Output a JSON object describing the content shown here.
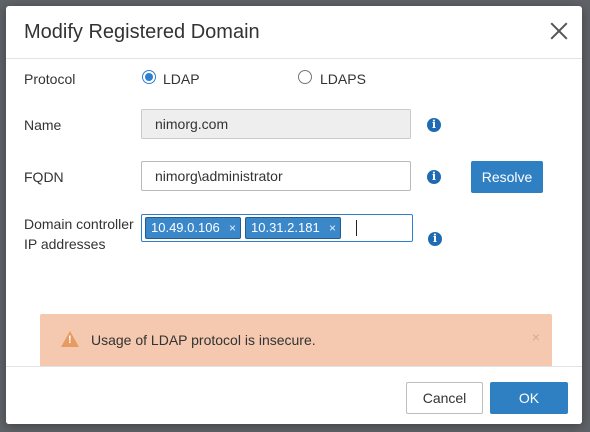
{
  "dialog": {
    "title": "Modify Registered Domain",
    "close_icon": "close-icon"
  },
  "protocol": {
    "label": "Protocol",
    "options": [
      {
        "label": "LDAP",
        "selected": true
      },
      {
        "label": "LDAPS",
        "selected": false
      }
    ]
  },
  "name": {
    "label": "Name",
    "value": "nimorg.com",
    "info_icon": "info-icon"
  },
  "fqdn": {
    "label": "FQDN",
    "value": "nimorg\\administrator",
    "info_icon": "info-icon",
    "resolve_label": "Resolve"
  },
  "dc": {
    "label": "Domain controller IP addresses",
    "tags": [
      "10.49.0.106",
      "10.31.2.181"
    ],
    "tag_remove_glyph": "×",
    "info_icon": "info-icon"
  },
  "warning": {
    "text": "Usage of LDAP protocol is insecure.",
    "icon": "warning-icon",
    "close_glyph": "×"
  },
  "footer": {
    "cancel_label": "Cancel",
    "ok_label": "OK"
  },
  "colors": {
    "primary": "#2f7fc3",
    "warning_bg": "#f4c9b0",
    "tag_bg": "#3a87c9"
  }
}
